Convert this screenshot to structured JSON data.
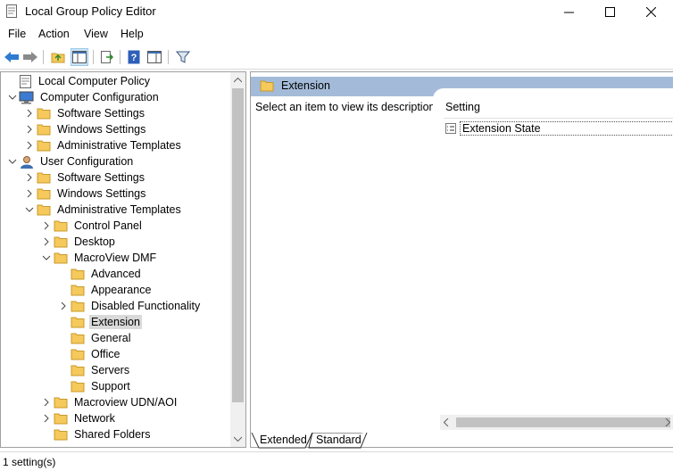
{
  "window": {
    "title": "Local Group Policy Editor"
  },
  "menu": [
    "File",
    "Action",
    "View",
    "Help"
  ],
  "tree": [
    {
      "label": "Local Computer Policy",
      "icon": "policy-icon",
      "chevron": "none"
    },
    {
      "label": "Computer Configuration",
      "icon": "computer-icon",
      "chevron": "expanded"
    },
    {
      "label": "Software Settings",
      "icon": "folder-icon",
      "chevron": "collapsed"
    },
    {
      "label": "Windows Settings",
      "icon": "folder-icon",
      "chevron": "collapsed"
    },
    {
      "label": "Administrative Templates",
      "icon": "folder-icon",
      "chevron": "collapsed"
    },
    {
      "label": "User Configuration",
      "icon": "user-icon",
      "chevron": "expanded"
    },
    {
      "label": "Software Settings",
      "icon": "folder-icon",
      "chevron": "collapsed"
    },
    {
      "label": "Windows Settings",
      "icon": "folder-icon",
      "chevron": "collapsed"
    },
    {
      "label": "Administrative Templates",
      "icon": "folder-icon",
      "chevron": "expanded"
    },
    {
      "label": "Control Panel",
      "icon": "folder-icon",
      "chevron": "collapsed"
    },
    {
      "label": "Desktop",
      "icon": "folder-icon",
      "chevron": "collapsed"
    },
    {
      "label": "MacroView DMF",
      "icon": "folder-icon",
      "chevron": "expanded"
    },
    {
      "label": "Advanced",
      "icon": "folder-icon",
      "chevron": "none"
    },
    {
      "label": "Appearance",
      "icon": "folder-icon",
      "chevron": "none"
    },
    {
      "label": "Disabled Functionality",
      "icon": "folder-icon",
      "chevron": "collapsed"
    },
    {
      "label": "Extension",
      "icon": "folder-icon",
      "chevron": "none",
      "selected": true
    },
    {
      "label": "General",
      "icon": "folder-icon",
      "chevron": "none"
    },
    {
      "label": "Office",
      "icon": "folder-icon",
      "chevron": "none"
    },
    {
      "label": "Servers",
      "icon": "folder-icon",
      "chevron": "none"
    },
    {
      "label": "Support",
      "icon": "folder-icon",
      "chevron": "none"
    },
    {
      "label": "Macroview UDN/AOI",
      "icon": "folder-icon",
      "chevron": "collapsed"
    },
    {
      "label": "Network",
      "icon": "folder-icon",
      "chevron": "collapsed"
    },
    {
      "label": "Shared Folders",
      "icon": "folder-icon",
      "chevron": "none"
    }
  ],
  "right_pane": {
    "header": "Extension",
    "description": "Select an item to view its description.",
    "column_header": "Setting",
    "rows": [
      {
        "label": "Extension State",
        "icon": "setting-icon"
      }
    ]
  },
  "tabs": [
    "Extended",
    "Standard"
  ],
  "status": "1 setting(s)",
  "colors": {
    "header_bg": "#a3bbd8",
    "selection_bg": "#d9d9d9",
    "folder": "#f5c95b"
  }
}
